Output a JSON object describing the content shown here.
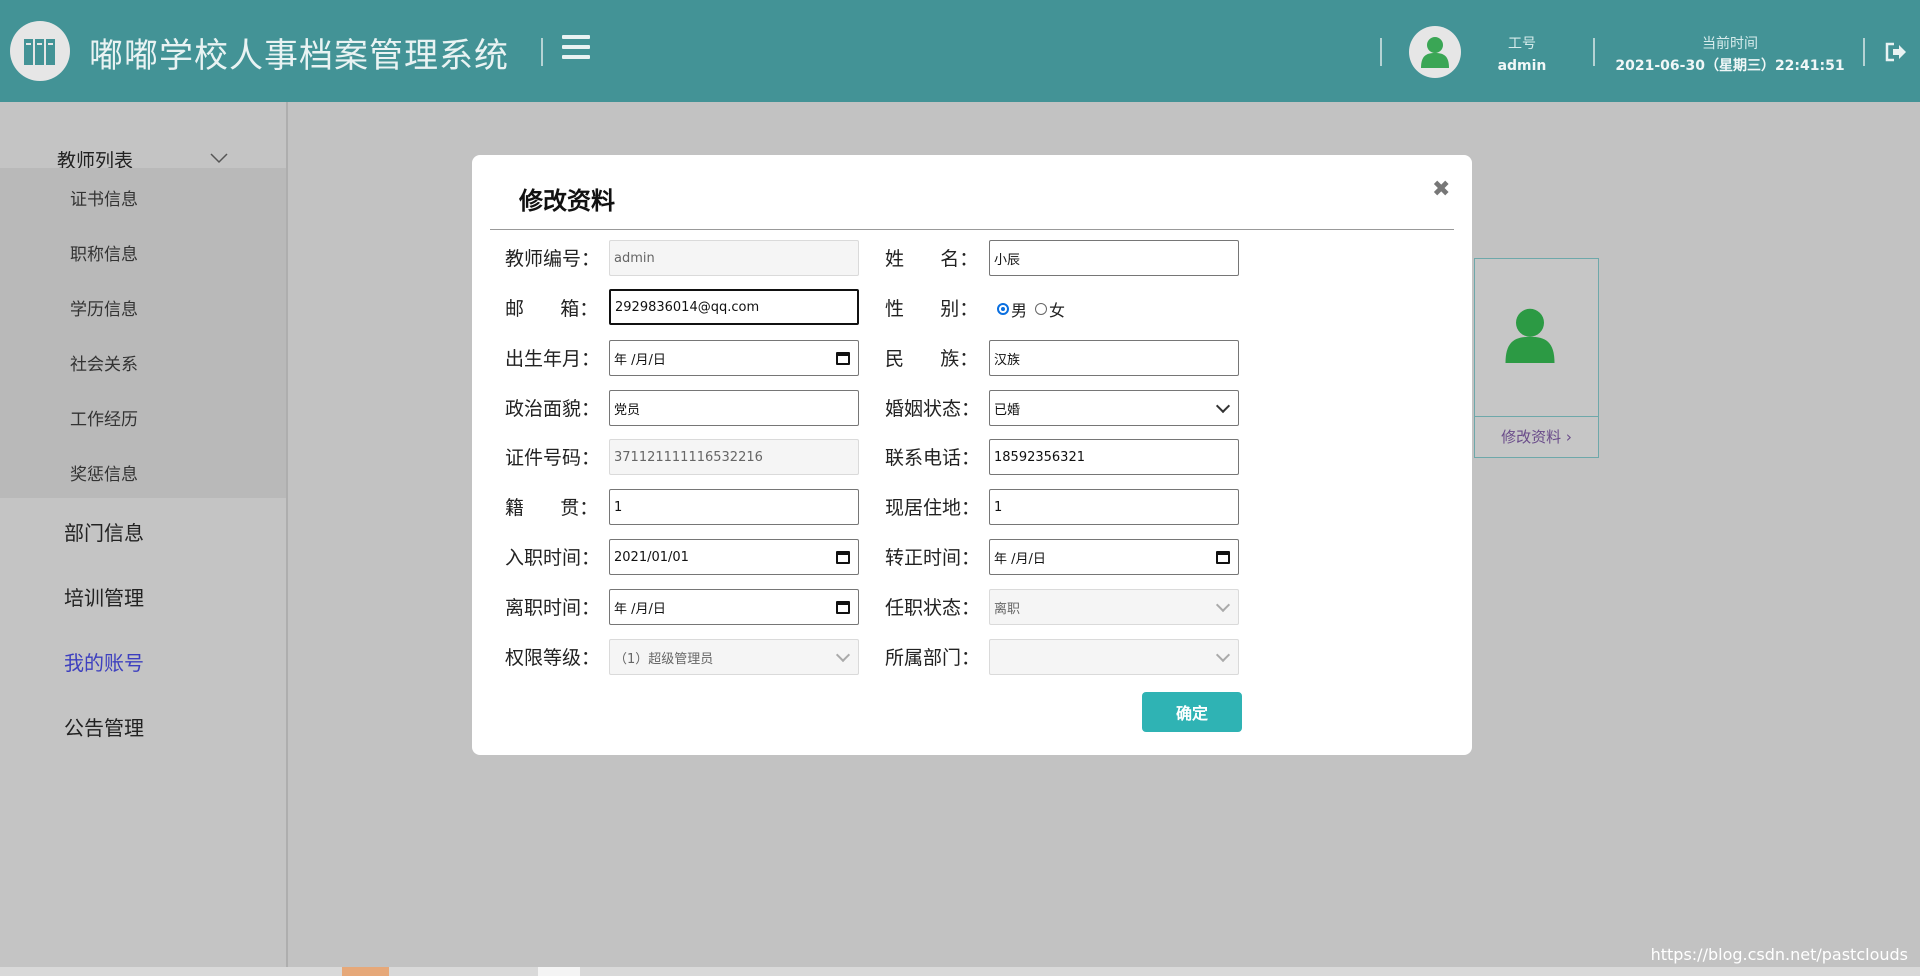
{
  "header": {
    "app_title": "嘟嘟学校人事档案管理系统",
    "user_id_label": "工号",
    "user_id": "admin",
    "time_label": "当前时间",
    "time_value": "2021-06-30（星期三）22:41:51"
  },
  "sidebar": {
    "group_title": "教师列表",
    "sub_items": [
      "证书信息",
      "职称信息",
      "学历信息",
      "社会关系",
      "工作经历",
      "奖惩信息"
    ],
    "items": [
      "部门信息",
      "培训管理",
      "我的账号",
      "公告管理"
    ],
    "active_item": "我的账号"
  },
  "profile_card": {
    "edit_label": "修改资料 ›"
  },
  "modal": {
    "title": "修改资料",
    "close": "✖",
    "confirm_label": "确定",
    "fields": {
      "teacher_no": {
        "label": "教师编号：",
        "value": "admin"
      },
      "name": {
        "label": "姓      名：",
        "value": "小辰"
      },
      "email": {
        "label": "邮      箱：",
        "value": "2929836014@qq.com"
      },
      "gender": {
        "label": "性      别：",
        "options": [
          "男",
          "女"
        ],
        "selected": "男"
      },
      "birth": {
        "label": "出生年月：",
        "value": "年 /月/日"
      },
      "ethnic": {
        "label": "民      族：",
        "value": "汉族"
      },
      "politics": {
        "label": "政治面貌：",
        "value": "党员"
      },
      "marital": {
        "label": "婚姻状态：",
        "value": "已婚"
      },
      "id_no": {
        "label": "证件号码：",
        "value": "371121111116532216"
      },
      "phone": {
        "label": "联系电话：",
        "value": "18592356321"
      },
      "native": {
        "label": "籍      贯：",
        "value": "1"
      },
      "address": {
        "label": "现居住地：",
        "value": "1"
      },
      "hire_date": {
        "label": "入职时间：",
        "value": "2021/01/01"
      },
      "regular_date": {
        "label": "转正时间：",
        "value": "年 /月/日"
      },
      "leave_date": {
        "label": "离职时间：",
        "value": "年 /月/日"
      },
      "job_status": {
        "label": "任职状态：",
        "value": "离职"
      },
      "permission": {
        "label": "权限等级：",
        "value": "（1）超级管理员"
      },
      "department": {
        "label": "所属部门：",
        "value": ""
      }
    }
  },
  "watermark": "https://blog.csdn.net/pastclouds",
  "colors": {
    "header_bg": "#439396",
    "active_nav": "#3d3fbf",
    "confirm_btn": "#2fb3b4",
    "avatar_green": "#3aa655"
  }
}
